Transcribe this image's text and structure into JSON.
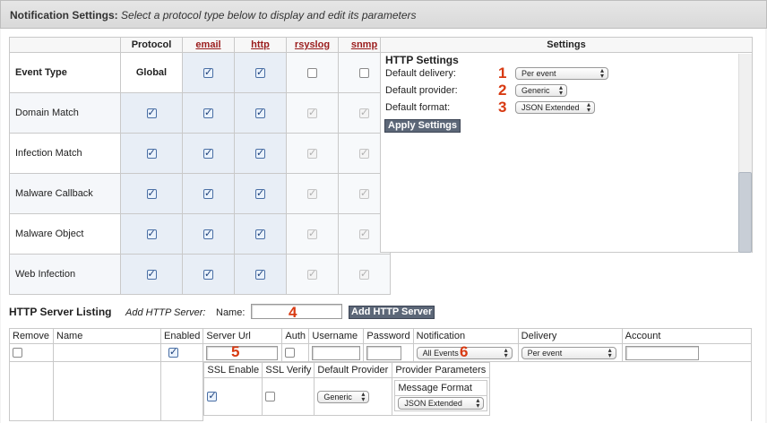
{
  "header": {
    "title": "Notification Settings:",
    "subtitle": "Select a protocol type below to display and edit its parameters"
  },
  "event_table": {
    "col_protocol": "Protocol",
    "col_global": "Global",
    "col_event_type": "Event Type",
    "protocols": [
      "email",
      "http",
      "rsyslog",
      "snmp"
    ],
    "rows": [
      {
        "name": "Domain Match",
        "global": true,
        "email": true,
        "http": true,
        "rsyslog": "disabled",
        "snmp": "disabled"
      },
      {
        "name": "Infection Match",
        "global": true,
        "email": true,
        "http": true,
        "rsyslog": "disabled",
        "snmp": "disabled"
      },
      {
        "name": "Malware Callback",
        "global": true,
        "email": true,
        "http": true,
        "rsyslog": "disabled",
        "snmp": "disabled"
      },
      {
        "name": "Malware Object",
        "global": true,
        "email": true,
        "http": true,
        "rsyslog": "disabled",
        "snmp": "disabled"
      },
      {
        "name": "Web Infection",
        "global": true,
        "email": true,
        "http": true,
        "rsyslog": "disabled",
        "snmp": "disabled"
      }
    ],
    "header_checks": {
      "email": true,
      "http": true,
      "rsyslog": false,
      "snmp": false
    }
  },
  "settings": {
    "title": "Settings",
    "http_title": "HTTP Settings",
    "delivery_label": "Default delivery:",
    "delivery_value": "Per event",
    "provider_label": "Default provider:",
    "provider_value": "Generic",
    "format_label": "Default format:",
    "format_value": "JSON Extended",
    "apply_label": "Apply Settings",
    "callouts": [
      "1",
      "2",
      "3",
      "4",
      "5",
      "6"
    ]
  },
  "listing": {
    "title": "HTTP Server Listing",
    "add_label": "Add HTTP Server:",
    "name_label": "Name:",
    "add_button": "Add HTTP Server",
    "columns": [
      "Remove",
      "Name",
      "Enabled",
      "Server Url",
      "Auth",
      "Username",
      "Password",
      "Notification",
      "Delivery",
      "Account"
    ],
    "row": {
      "remove": false,
      "enabled": true,
      "auth": false,
      "notification": "All Events",
      "delivery": "Per event"
    },
    "sub_columns": [
      "SSL Enable",
      "SSL Verify",
      "Default Provider",
      "Provider Parameters"
    ],
    "sub_row": {
      "ssl_enable": true,
      "ssl_verify": false,
      "default_provider": "Generic",
      "message_format_label": "Message Format",
      "message_format_value": "JSON Extended"
    }
  }
}
